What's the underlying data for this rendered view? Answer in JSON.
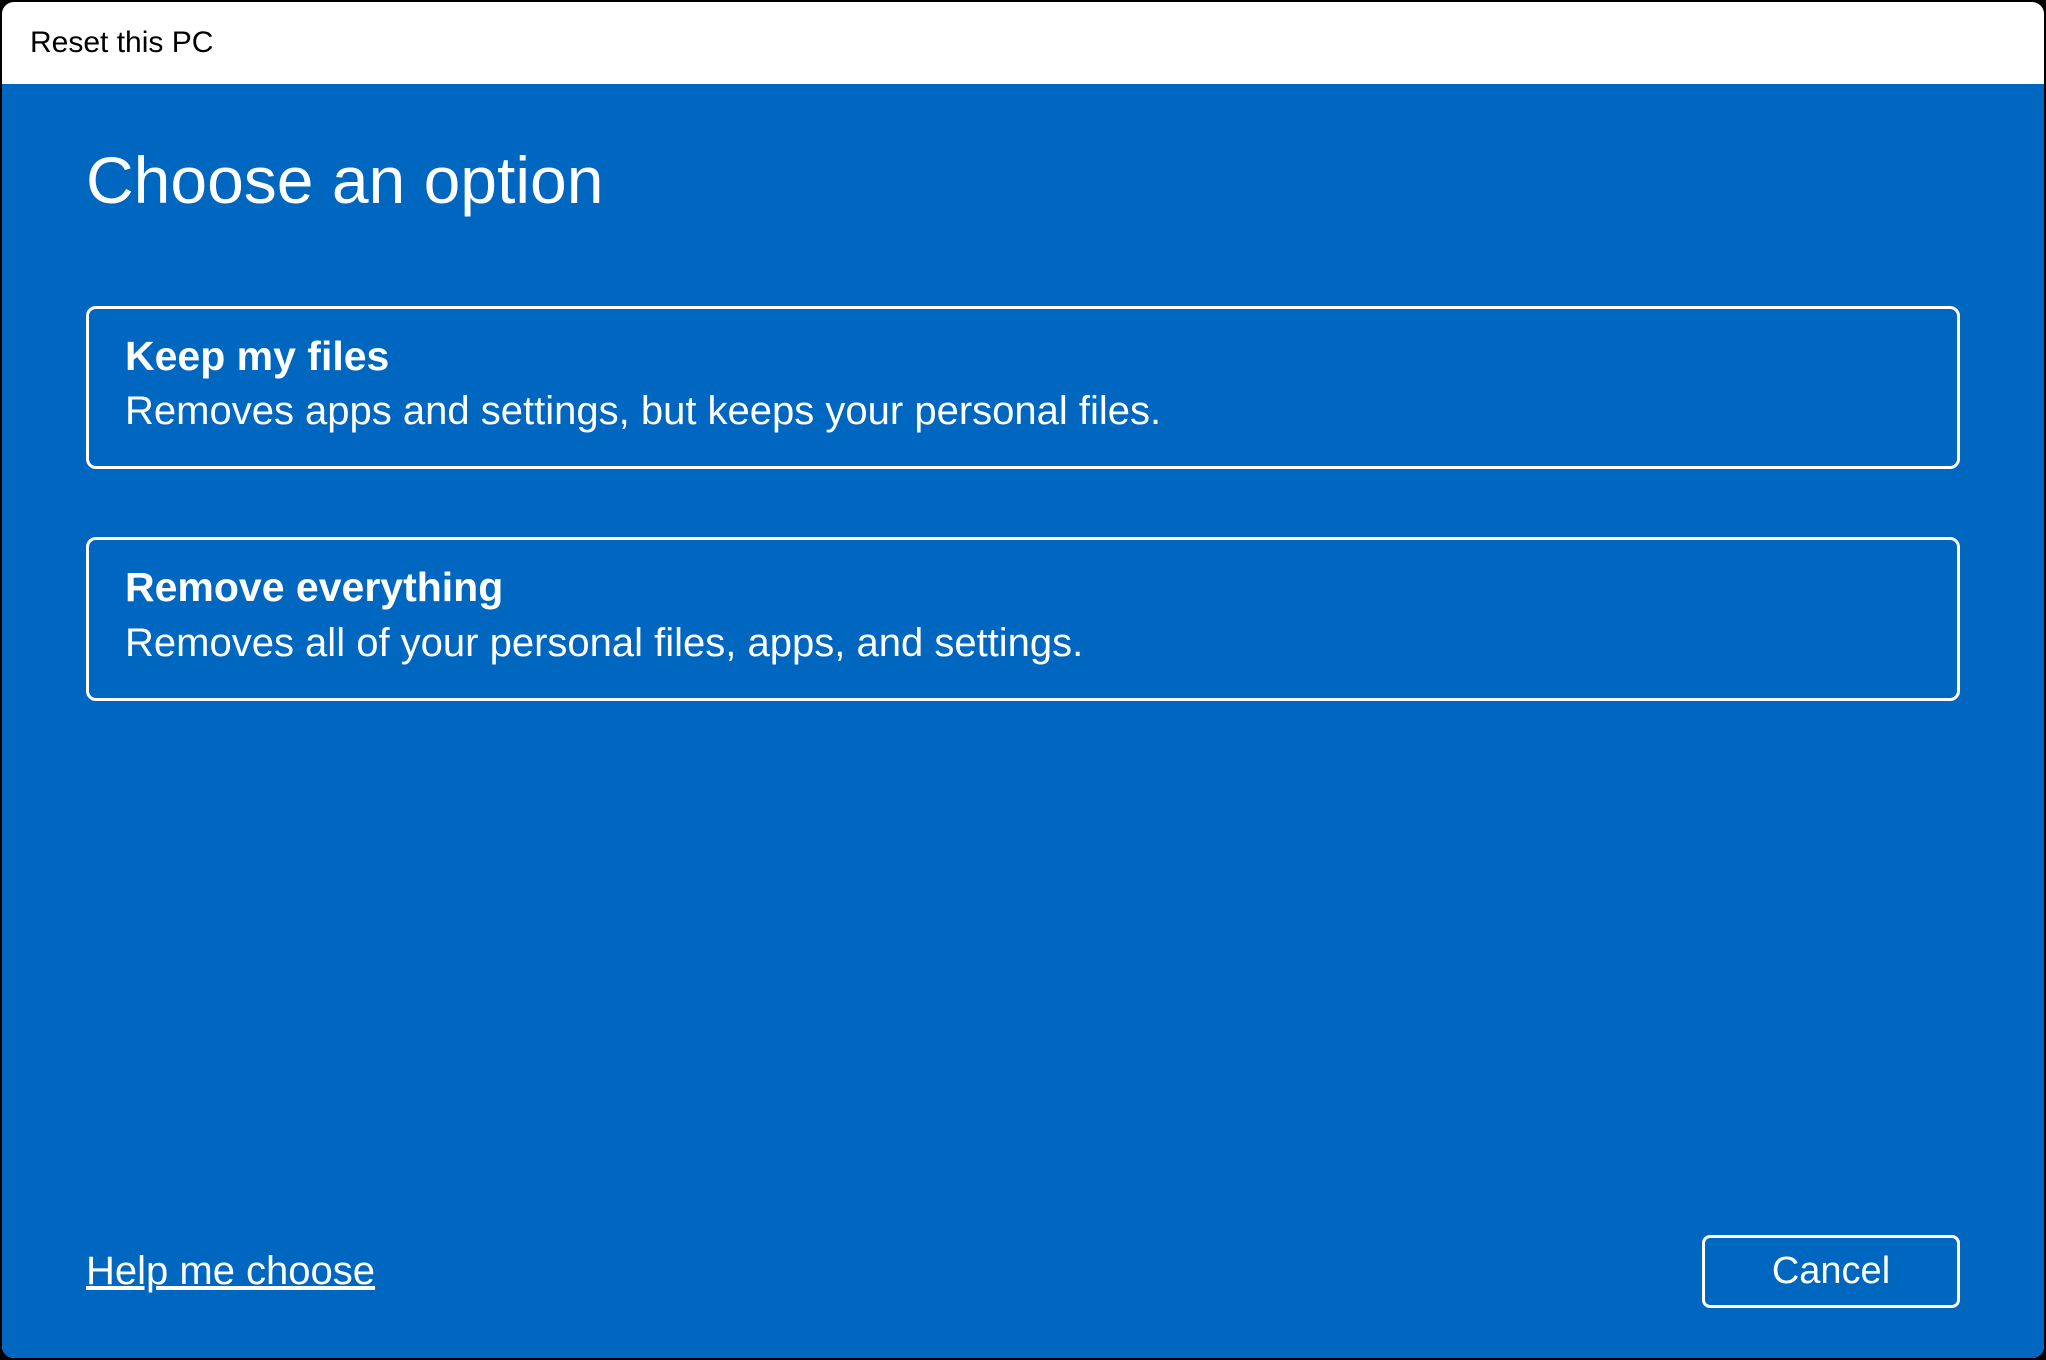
{
  "window": {
    "title": "Reset this PC"
  },
  "main": {
    "heading": "Choose an option",
    "options": [
      {
        "title": "Keep my files",
        "description": "Removes apps and settings, but keeps your personal files."
      },
      {
        "title": "Remove everything",
        "description": "Removes all of your personal files, apps, and settings."
      }
    ]
  },
  "footer": {
    "help_label": "Help me choose",
    "cancel_label": "Cancel"
  },
  "colors": {
    "accent": "#0067c0"
  }
}
